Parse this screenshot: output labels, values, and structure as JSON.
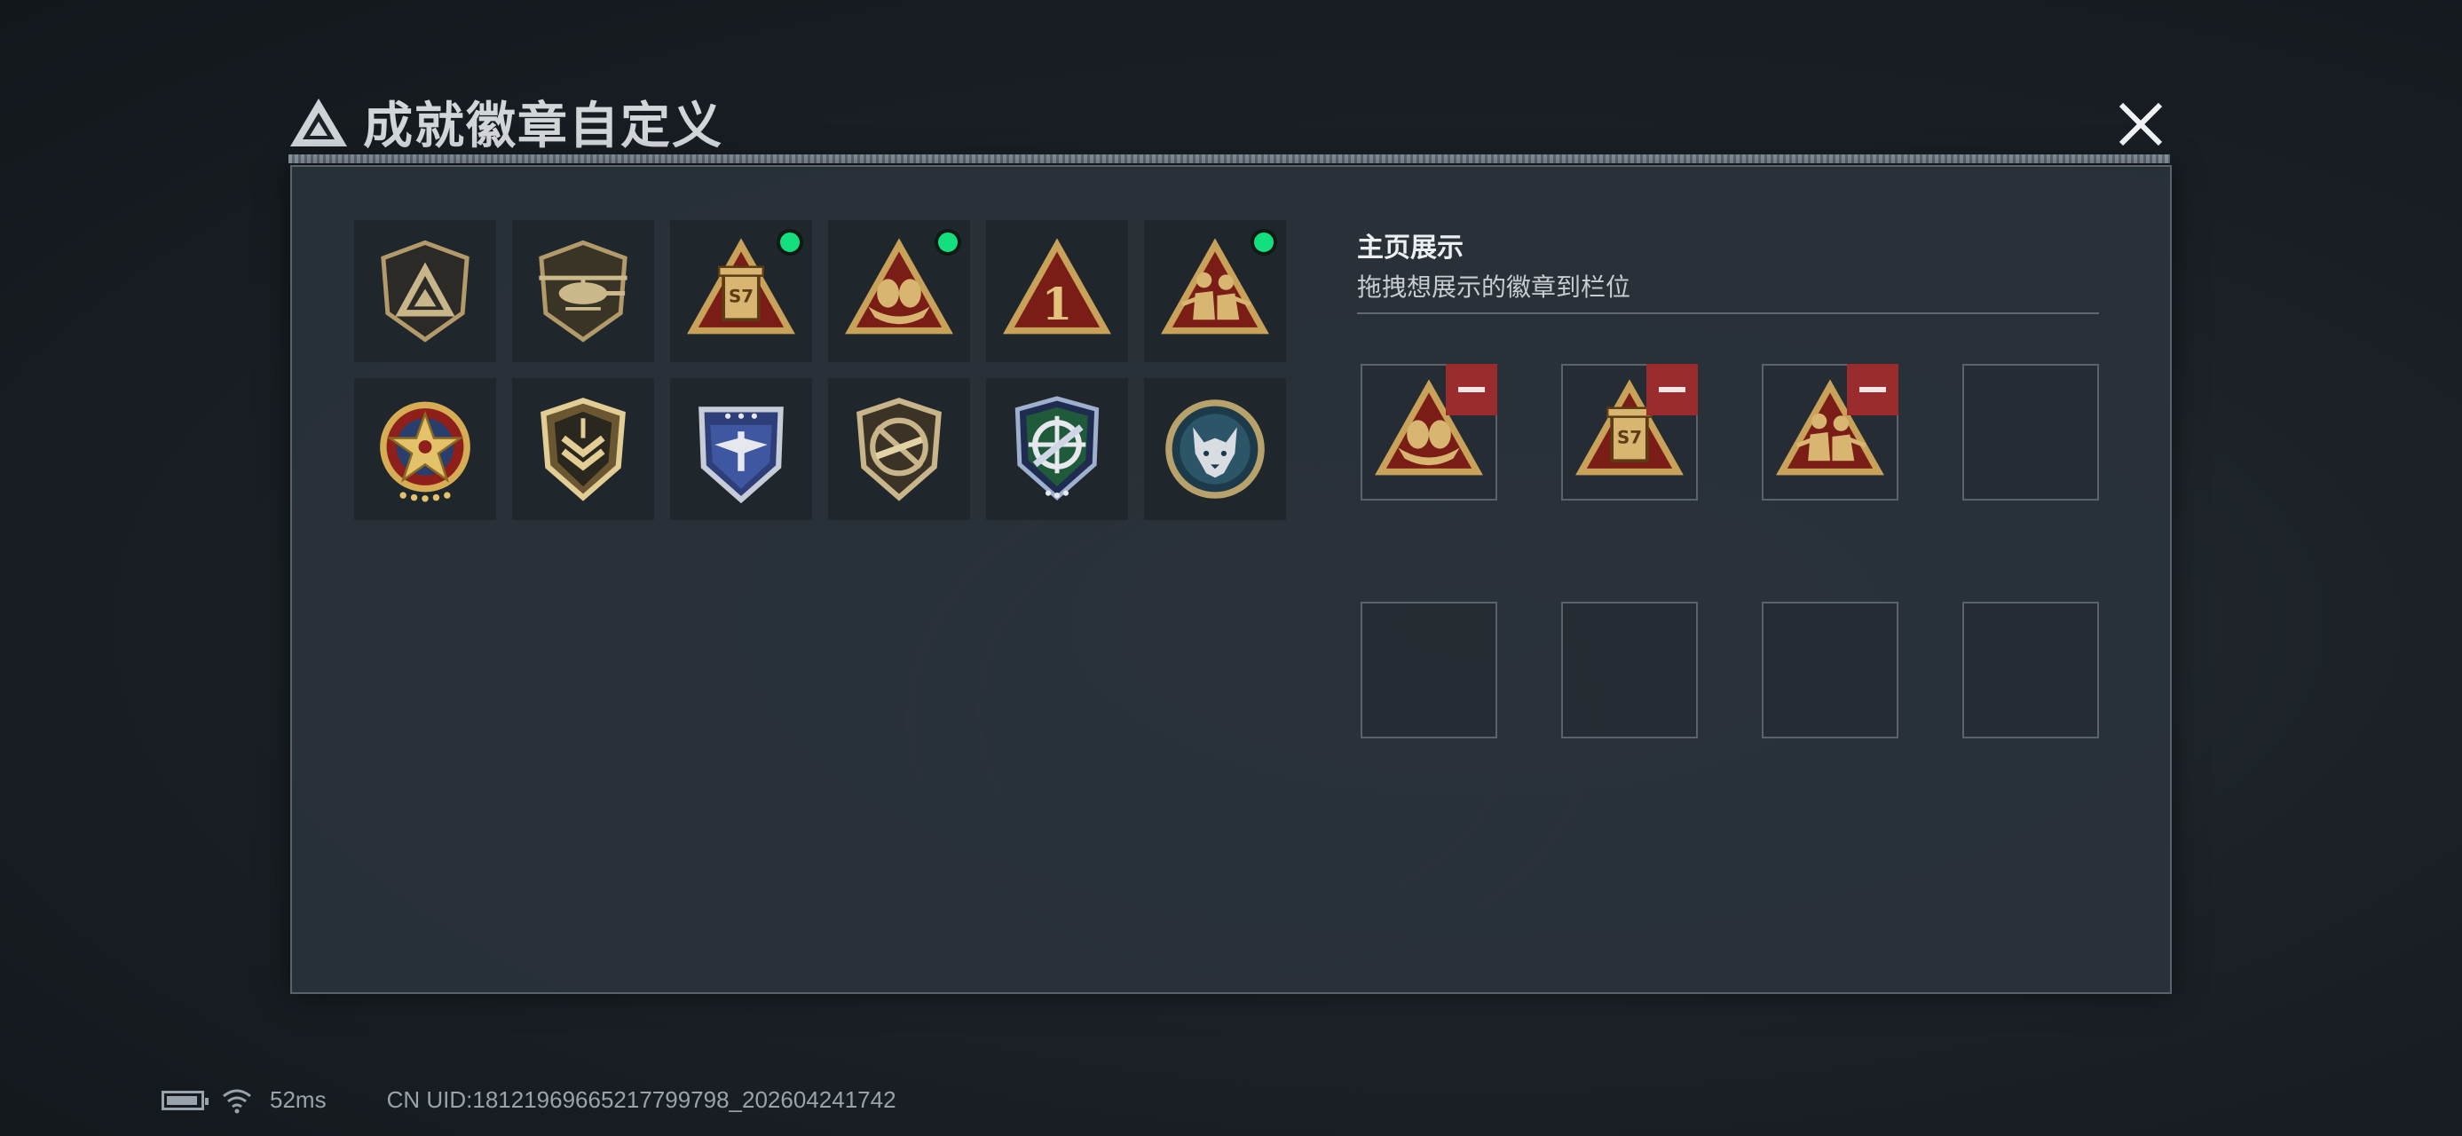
{
  "header": {
    "title": "成就徽章自定义",
    "logo_icon": "triangle-logo-icon",
    "close_icon": "close-icon"
  },
  "colors": {
    "equipped_dot": "#13df7e",
    "remove_button": "#9b2c2e",
    "badge_gold": "#c9a25a",
    "badge_red": "#7a1d16"
  },
  "badges": [
    {
      "icon": "triangle-shield-badge-icon",
      "equipped": false
    },
    {
      "icon": "helicopter-shield-badge-icon",
      "equipped": false
    },
    {
      "icon": "s7-crate-triangle-badge-icon",
      "label": "S7",
      "equipped": true
    },
    {
      "icon": "eggs-nest-triangle-badge-icon",
      "equipped": true
    },
    {
      "icon": "number-one-triangle-badge-icon",
      "label": "1",
      "equipped": false
    },
    {
      "icon": "soldiers-triangle-badge-icon",
      "equipped": true
    },
    {
      "icon": "star-wreath-badge-icon",
      "equipped": false
    },
    {
      "icon": "rank-chevron-shield-badge-icon",
      "equipped": false
    },
    {
      "icon": "winged-blue-shield-badge-icon",
      "equipped": false
    },
    {
      "icon": "rifle-crossed-shield-badge-icon",
      "equipped": false
    },
    {
      "icon": "crosshair-green-shield-badge-icon",
      "equipped": false
    },
    {
      "icon": "wolf-round-badge-icon",
      "equipped": false
    }
  ],
  "showcase": {
    "title": "主页展示",
    "subtitle": "拖拽想展示的徽章到栏位",
    "slots": [
      {
        "icon": "eggs-nest-triangle-badge-icon",
        "removable": true
      },
      {
        "icon": "s7-crate-triangle-badge-icon",
        "label": "S7",
        "removable": true
      },
      {
        "icon": "soldiers-triangle-badge-icon",
        "removable": true
      },
      {
        "icon": null
      },
      {
        "icon": null
      },
      {
        "icon": null
      },
      {
        "icon": null
      },
      {
        "icon": null
      }
    ]
  },
  "status_bar": {
    "ping": "52ms",
    "uid": "CN UID:18121969665217799798_202604241742",
    "battery_icon": "battery-icon",
    "wifi_icon": "wifi-icon",
    "battery_level": 0.8
  }
}
